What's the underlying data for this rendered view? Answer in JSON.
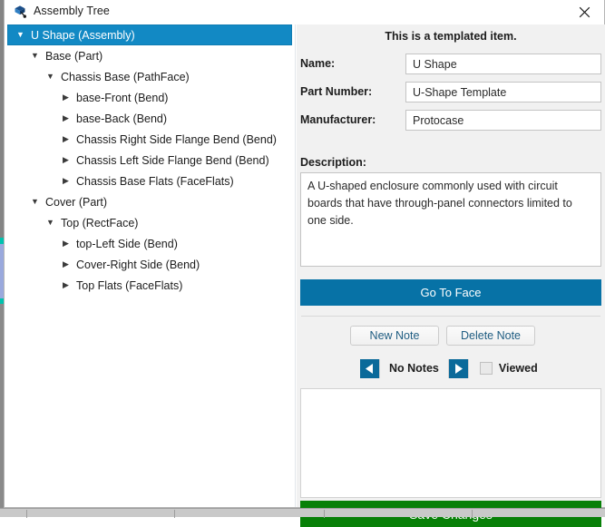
{
  "window": {
    "title": "Assembly Tree",
    "icon": "assembly-tree-icon",
    "close_label": "✕"
  },
  "tree": {
    "items": [
      {
        "label": "U Shape (Assembly)",
        "depth": 0,
        "twisty": "▼",
        "selected": true
      },
      {
        "label": "Base (Part)",
        "depth": 1,
        "twisty": "▼",
        "selected": false
      },
      {
        "label": "Chassis Base (PathFace)",
        "depth": 2,
        "twisty": "▼",
        "selected": false
      },
      {
        "label": "base-Front (Bend)",
        "depth": 3,
        "twisty": "▶",
        "selected": false
      },
      {
        "label": "base-Back (Bend)",
        "depth": 3,
        "twisty": "▶",
        "selected": false
      },
      {
        "label": "Chassis Right Side Flange Bend (Bend)",
        "depth": 3,
        "twisty": "▶",
        "selected": false
      },
      {
        "label": "Chassis Left Side Flange Bend (Bend)",
        "depth": 3,
        "twisty": "▶",
        "selected": false
      },
      {
        "label": "Chassis Base Flats (FaceFlats)",
        "depth": 3,
        "twisty": "▶",
        "selected": false
      },
      {
        "label": "Cover (Part)",
        "depth": 1,
        "twisty": "▼",
        "selected": false
      },
      {
        "label": "Top (RectFace)",
        "depth": 2,
        "twisty": "▼",
        "selected": false
      },
      {
        "label": "top-Left Side (Bend)",
        "depth": 3,
        "twisty": "▶",
        "selected": false
      },
      {
        "label": "Cover-Right Side (Bend)",
        "depth": 3,
        "twisty": "▶",
        "selected": false
      },
      {
        "label": "Top Flats (FaceFlats)",
        "depth": 3,
        "twisty": "▶",
        "selected": false
      }
    ]
  },
  "details": {
    "heading": "This is a templated item.",
    "name_label": "Name:",
    "name_value": "U Shape",
    "name_placeholder": "",
    "part_number_label": "Part Number:",
    "part_number_value": "U-Shape Template",
    "part_number_placeholder": "",
    "manufacturer_label": "Manufacturer:",
    "manufacturer_value": "Protocase",
    "manufacturer_placeholder": "",
    "description_label": "Description:",
    "description_value": "A U-shaped enclosure commonly used with circuit boards that have through-panel connectors limited to one side.",
    "description_placeholder": "",
    "goto_face_label": "Go To Face"
  },
  "notes": {
    "new_note_label": "New Note",
    "delete_note_label": "Delete Note",
    "prev_icon": "left-arrow-icon",
    "next_icon": "right-arrow-icon",
    "count_label": "No Notes",
    "viewed_label": "Viewed",
    "note_text_value": "",
    "note_text_placeholder": ""
  },
  "footer": {
    "save_label": "Save Changes"
  },
  "colors": {
    "accent_blue": "#0772a6",
    "selection_blue": "#1289c4",
    "nav_blue": "#0b6a9a",
    "save_green": "#088008",
    "panel_bg": "#f1f1f1",
    "link_text": "#1f5d82"
  }
}
